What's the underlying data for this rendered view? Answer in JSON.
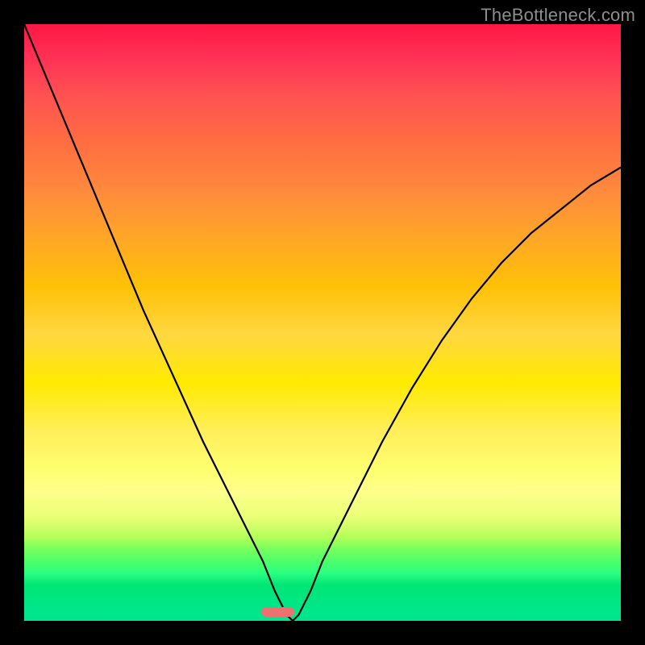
{
  "watermark": "TheBottleneck.com",
  "colors": {
    "background": "#000000",
    "gradient_top": "#ff1744",
    "gradient_mid": "#ffea00",
    "gradient_bottom": "#00e58e",
    "curve": "#000000",
    "marker": "#ef7070",
    "watermark_text": "#8d8d8d"
  },
  "marker": {
    "x_frac": 0.425,
    "y_frac": 0.985,
    "w_frac": 0.055,
    "h_frac": 0.016
  },
  "chart_data": {
    "type": "line",
    "title": "",
    "xlabel": "",
    "ylabel": "",
    "xlim": [
      0,
      100
    ],
    "ylim": [
      0,
      100
    ],
    "series": [
      {
        "name": "bottleneck-curve",
        "x": [
          0,
          5,
          10,
          15,
          20,
          25,
          30,
          35,
          40,
          42,
          44,
          45,
          46,
          48,
          50,
          55,
          60,
          65,
          70,
          75,
          80,
          85,
          90,
          95,
          100
        ],
        "y": [
          100,
          88,
          76,
          64,
          52,
          41,
          30,
          20,
          10,
          5,
          1,
          0,
          1,
          5,
          10,
          20,
          30,
          39,
          47,
          54,
          60,
          65,
          69,
          73,
          76
        ]
      }
    ],
    "annotations": [
      {
        "type": "marker",
        "x": 45,
        "y": 0,
        "label": "optimal-point"
      }
    ],
    "background_scale": "vertical gradient red (top=high bottleneck) → yellow → green (bottom=low bottleneck)"
  }
}
